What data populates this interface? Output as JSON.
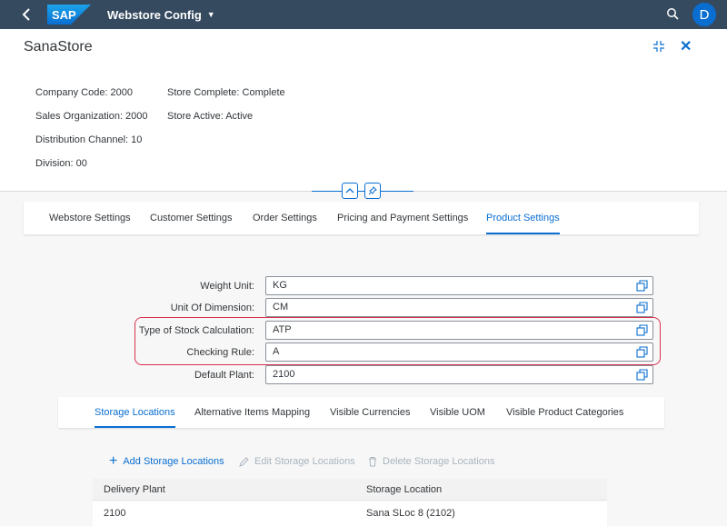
{
  "shell": {
    "back_icon": "back-icon",
    "logo_text": "SAP",
    "app_title": "Webstore Config",
    "avatar_initial": "D"
  },
  "header": {
    "title": "SanaStore",
    "attributes_left": [
      "Company Code: 2000",
      "Sales Organization: 2000",
      "Distribution Channel: 10",
      "Division: 00"
    ],
    "attributes_right": [
      "Store Complete: Complete",
      "Store Active: Active"
    ]
  },
  "tabs": [
    {
      "label": "Webstore Settings"
    },
    {
      "label": "Customer Settings"
    },
    {
      "label": "Order Settings"
    },
    {
      "label": "Pricing and Payment Settings"
    },
    {
      "label": "Product Settings",
      "active": true
    }
  ],
  "form": [
    {
      "label": "Weight Unit:",
      "value": "KG"
    },
    {
      "label": "Unit Of Dimension:",
      "value": "CM"
    },
    {
      "label": "Type of Stock Calculation:",
      "value": "ATP"
    },
    {
      "label": "Checking Rule:",
      "value": "A"
    },
    {
      "label": "Default Plant:",
      "value": "2100"
    }
  ],
  "subtabs": [
    {
      "label": "Storage Locations",
      "active": true
    },
    {
      "label": "Alternative Items Mapping"
    },
    {
      "label": "Visible Currencies"
    },
    {
      "label": "Visible UOM"
    },
    {
      "label": "Visible Product Categories"
    }
  ],
  "toolbar": {
    "add_label": "Add Storage Locations",
    "edit_label": "Edit Storage Locations",
    "delete_label": "Delete Storage Locations"
  },
  "table": {
    "columns": [
      "Delivery Plant",
      "Storage Location"
    ],
    "rows": [
      [
        "2100",
        "Sana SLoc 8 (2102)"
      ]
    ]
  },
  "colors": {
    "shell_bg": "#354a5f",
    "accent": "#0a6ed1",
    "highlight_border": "#d9304e"
  }
}
